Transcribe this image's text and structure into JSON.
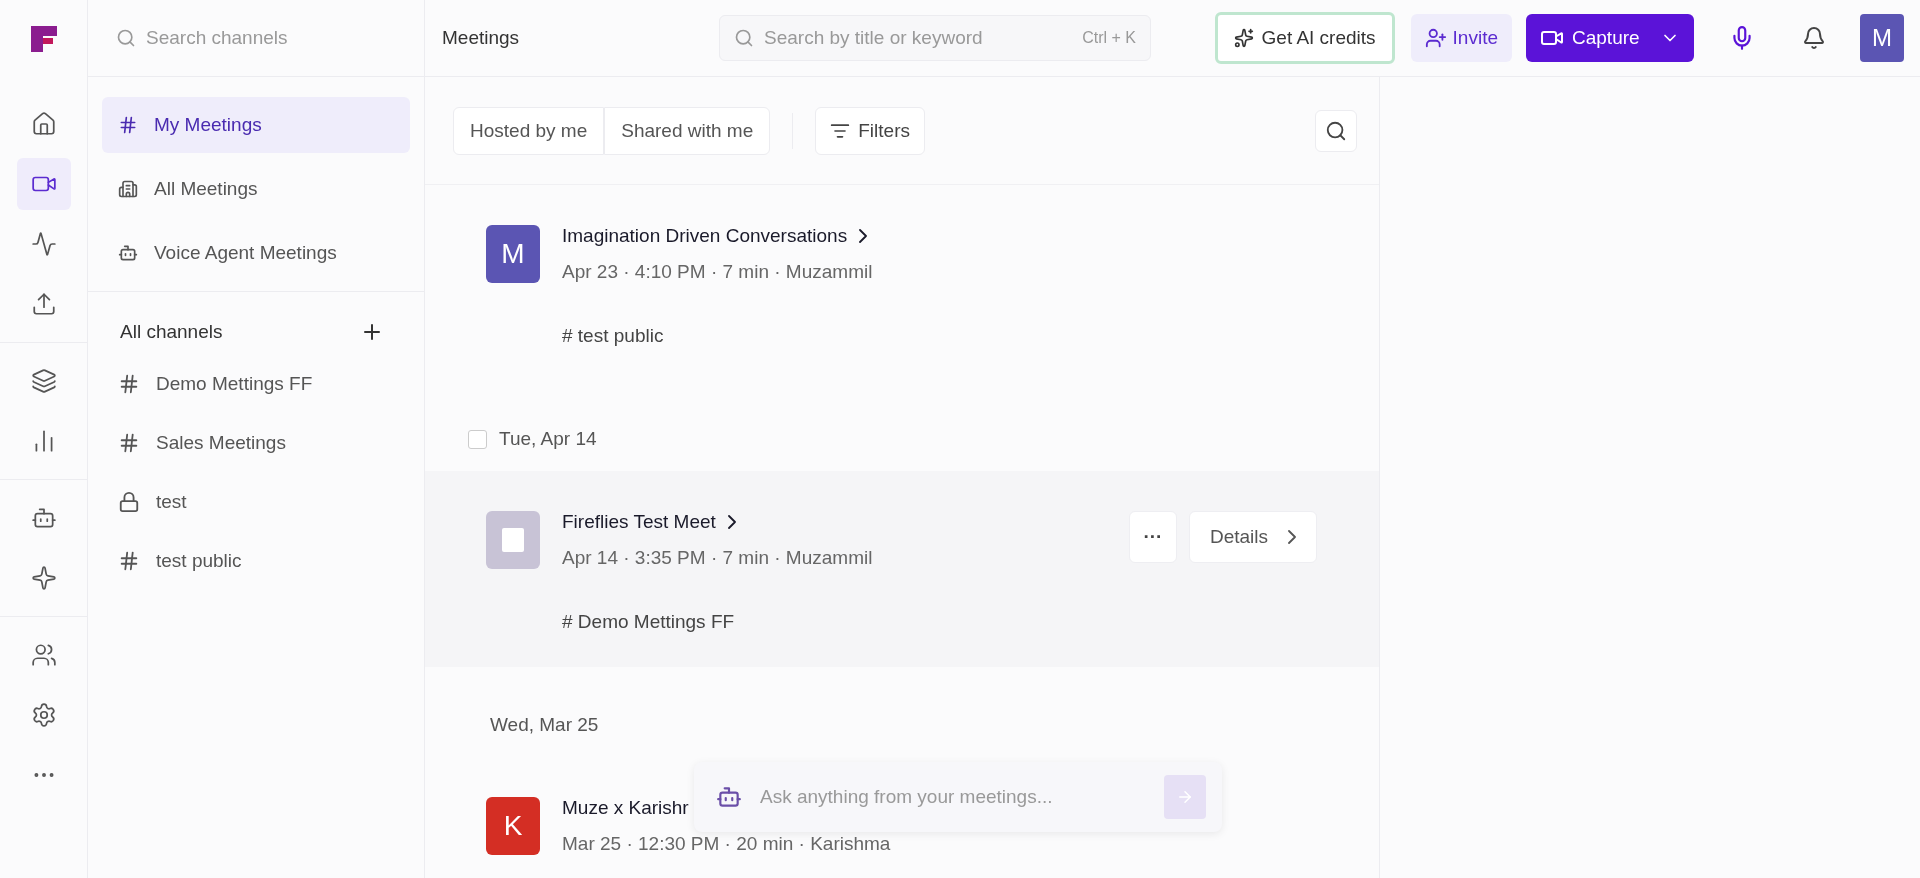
{
  "rail": [
    {
      "selected": false
    },
    {
      "selected": true
    },
    {
      "selected": false
    },
    {
      "selected": false
    },
    {
      "selected": false
    },
    {
      "selected": false
    },
    {
      "selected": false
    },
    {
      "selected": false
    },
    {
      "selected": false
    },
    {
      "selected": false
    },
    {
      "selected": false
    }
  ],
  "sidebar": {
    "search": {
      "placeholder": "Search channels"
    },
    "nav": [
      {
        "label": "My Meetings",
        "kind": "hash",
        "selected": true
      },
      {
        "label": "All Meetings",
        "kind": "building",
        "selected": false
      },
      {
        "label": "Voice Agent Meetings",
        "kind": "bot",
        "selected": false
      }
    ],
    "channels_title": "All channels",
    "channels": [
      {
        "label": "Demo Mettings FF",
        "kind": "public"
      },
      {
        "label": "Sales Meetings",
        "kind": "public"
      },
      {
        "label": "test",
        "kind": "private"
      },
      {
        "label": "test public",
        "kind": "public"
      }
    ]
  },
  "header": {
    "title": "Meetings",
    "search": {
      "placeholder": "Search by title or keyword",
      "shortcut": "Ctrl + K"
    },
    "ai_credits": "Get AI credits",
    "invite": "Invite",
    "capture": "Capture",
    "avatar": "M"
  },
  "filters": {
    "tabs": [
      {
        "label": "Hosted by me",
        "selected": false
      },
      {
        "label": "Shared with me",
        "selected": false
      }
    ],
    "filters_button": "Filters"
  },
  "groups": [
    {
      "meetings": [
        {
          "title": "Imagination Driven Conversations",
          "kind": "letter",
          "avatar": "M",
          "color": "#5b55b3",
          "meta": "Apr 23 · 4:10 PM · 7 min · Muzammil",
          "channel": "# test public",
          "hovered": false
        }
      ]
    },
    {
      "date": "Tue, Apr 14",
      "checked": false,
      "meetings": [
        {
          "title": "Fireflies Test Meet",
          "kind": "placeholder",
          "color": "#c8c3d6",
          "meta": "Apr 14 · 3:35 PM · 7 min · Muzammil",
          "channel": "# Demo Mettings FF",
          "hovered": true,
          "more": "···",
          "details": "Details"
        }
      ]
    },
    {
      "date": "Wed, Mar 25",
      "meetings": [
        {
          "title": "Muze x Karishr",
          "kind": "letter",
          "avatar": "K",
          "color": "#d42e24",
          "meta": "Mar 25 · 12:30 PM · 20 min · Karishma",
          "hovered": false
        }
      ]
    }
  ],
  "ask": {
    "placeholder": "Ask anything from your meetings..."
  }
}
